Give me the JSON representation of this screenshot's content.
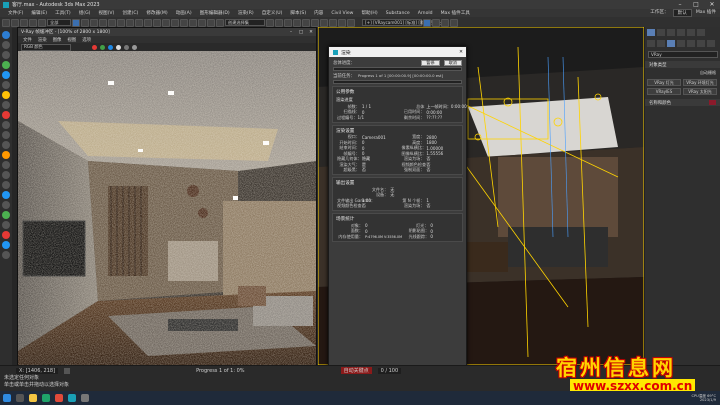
{
  "window": {
    "title": "客厅.max - Autodesk 3ds Max 2023"
  },
  "menu": [
    "文件(F)",
    "编辑(E)",
    "工具(T)",
    "组(G)",
    "视图(V)",
    "创建(C)",
    "修改器(M)",
    "动画(A)",
    "图形编辑器(D)",
    "渲染(R)",
    "自定义(U)",
    "脚本(S)",
    "内容",
    "Civil View",
    "帮助(H)",
    "Substance",
    "Arnold",
    "Max 插件工具"
  ],
  "menu_right": [
    "工作区：",
    "默认",
    "Max 插件"
  ],
  "toolbar": {
    "select_filter": "全部",
    "selection_set": "创建选择集",
    "viewport_label": "[+] [VRaycam001] [标准] [默认明暗处理]"
  },
  "vfb": {
    "title": "V-Ray 帧缓冲区 - [100% of 2800 x 1800]",
    "menu": [
      "文件",
      "渲染",
      "图像",
      "视图",
      "选项"
    ],
    "channel": "RGB 颜色"
  },
  "dialog": {
    "title": "渲染",
    "overall_label": "总体进度：",
    "pause": "暂停",
    "cancel": "取消",
    "current_task": "当前任务：",
    "task_value": "Progress 1 of 1   [00:00:00.9] [00:00:00.0 est]",
    "sections": {
      "common": "公用参数",
      "render_progress": "渲染进度",
      "render_settings": "渲染设置",
      "output_settings": "输出设置",
      "scene_stats": "场景统计"
    },
    "progress_rows": [
      [
        "帧数：",
        "1 / 1"
      ],
      [
        "扫描线：",
        "0"
      ],
      [
        "总体",
        "上一帧时间：0:00:00"
      ],
      [
        "已用时间：",
        "0:00:00"
      ],
      [
        "剩余时间：",
        "??:??:??"
      ]
    ],
    "pass": "过程编号：1/1",
    "settings_rows": [
      [
        "视口：",
        "Camera001"
      ],
      [
        "开始时间：",
        "0"
      ],
      [
        "结束时间：",
        "0"
      ],
      [
        "帧编号：",
        "0"
      ],
      [
        "宽度：",
        "2800"
      ],
      [
        "高度：",
        "1800"
      ],
      [
        "像素纵横比：",
        "1.00000"
      ],
      [
        "图像纵横比：",
        "1.55556"
      ],
      [
        "隐藏几何体：",
        "隐藏"
      ],
      [
        "渲染大气：",
        "是"
      ],
      [
        "渲染为场：",
        "否"
      ],
      [
        "视频颜色检查：",
        "否"
      ],
      [
        "超级黑：",
        "否"
      ],
      [
        "强制双面：",
        "否"
      ]
    ],
    "output_rows": [
      [
        "文件名：",
        "无"
      ],
      [
        "设备：",
        "无"
      ],
      [
        "文件输出 Gamma：",
        "1.00"
      ],
      [
        "第 N 个帧：",
        "1"
      ],
      [
        "视频颜色检查：",
        "否"
      ],
      [
        "渲染为场：",
        "否"
      ]
    ],
    "scene_rows": [
      [
        "对象：",
        "0"
      ],
      [
        "灯光：",
        "0"
      ],
      [
        "面数：",
        "0"
      ],
      [
        "阴影贴图：",
        "0"
      ],
      [
        "内存使用量：",
        "P:4796.0M V:3556.0M"
      ],
      [
        "光线跟踪：",
        "0"
      ]
    ]
  },
  "command_panel": {
    "category": "VRay",
    "rollout1": "对象类型",
    "auto_grid": "自动栅格",
    "buttons": [
      "VRay 灯光",
      "VRay 环境灯光",
      "VRayIES",
      "VRay 太阳光"
    ],
    "rollout2": "名称和颜色",
    "swatch_color": "#8b1a2b"
  },
  "status": {
    "coords": "X: [1406, 218]",
    "msg1": "未选定任何对象",
    "msg2": "单击或单击并拖动以选择对象",
    "progress_text": "Progress 1 of 1: 0%",
    "anim": "自动关键点",
    "time_field": "0 / 100"
  },
  "taskbar": {
    "time": "CPU温度 69°C",
    "date": "2023/1/9"
  },
  "watermark": {
    "cn": "宿州信息网",
    "url": "www.szxx.com.cn"
  },
  "colors": {
    "accent": "#3b6fb0",
    "wm_yellow": "#ffd400",
    "wm_red": "#e00000"
  }
}
